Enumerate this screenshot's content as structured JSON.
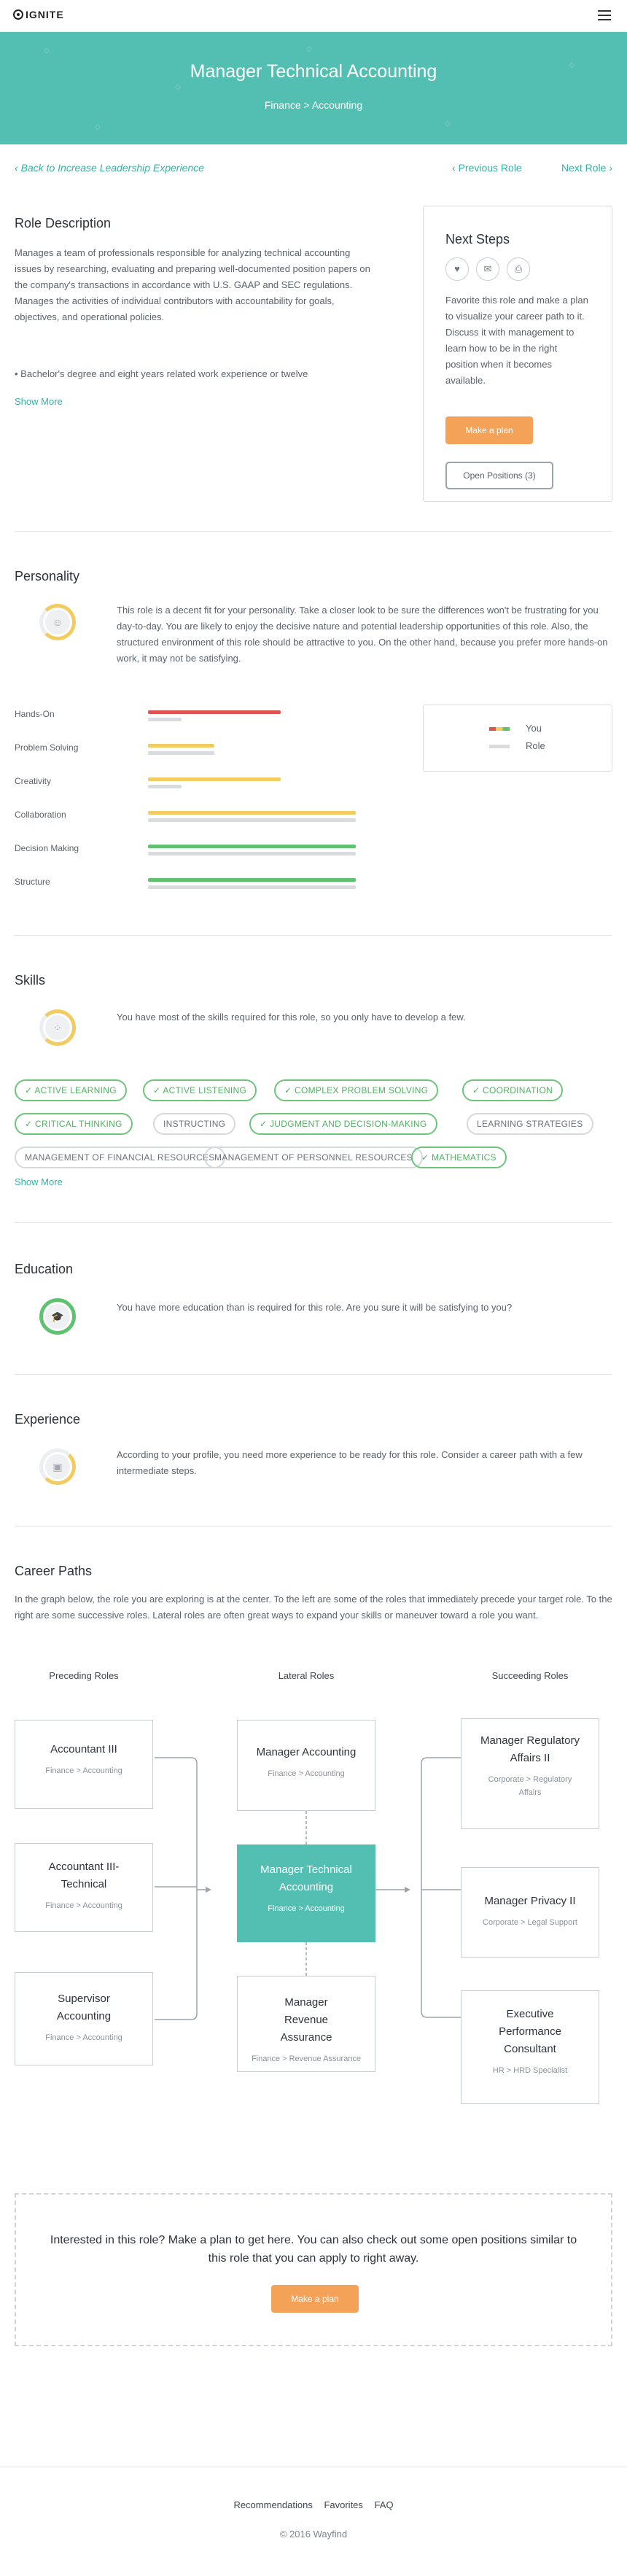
{
  "brand": {
    "name": "IGNITE"
  },
  "header": {
    "title": "Manager Technical Accounting",
    "breadcrumb": "Finance > Accounting"
  },
  "subnav": {
    "back": "Back to Increase Leadership Experience",
    "previous": "Previous Role",
    "next": "Next Role"
  },
  "role_description": {
    "heading": "Role Description",
    "text": "Manages a team of professionals responsible for analyzing technical accounting issues by researching, evaluating and preparing well-documented position papers on the company's transactions in accordance with U.S. GAAP and SEC regulations. Manages the activities of individual contributors with accountability for goals, objectives, and operational policies.",
    "bullet": "• Bachelor's degree and eight years related work experience or twelve",
    "show_more": "Show More"
  },
  "next_steps": {
    "heading": "Next Steps",
    "text": "Favorite this role and make a plan to visualize your career path to it. Discuss it with management to learn how to be in the right position when it becomes available.",
    "make_plan": "Make a plan",
    "open_positions": "Open Positions (3)",
    "icons": [
      "heart-icon",
      "mail-icon",
      "print-icon"
    ]
  },
  "personality": {
    "heading": "Personality",
    "text": "This role is a decent fit for your personality. Take a closer look to be sure the differences won't be frustrating for you day-to-day. You are likely to enjoy the decisive nature and potential leadership opportunities of this role. Also, the structured environment of this role should be attractive to you. On the other hand, because you prefer more hands-on work, it may not be satisfying.",
    "traits": [
      {
        "label": "Hands-On",
        "you": 0.8,
        "role": 0.2,
        "color": "#e05353"
      },
      {
        "label": "Problem Solving",
        "you": 0.4,
        "role": 0.4,
        "color": "#f2cc60"
      },
      {
        "label": "Creativity",
        "you": 0.8,
        "role": 0.2,
        "color": "#f2cc60"
      },
      {
        "label": "Collaboration",
        "you": 1.0,
        "role": 1.0,
        "color": "#f2cc60"
      },
      {
        "label": "Decision Making",
        "you": 1.0,
        "role": 1.0,
        "color": "#5fc26f"
      },
      {
        "label": "Structure",
        "you": 1.0,
        "role": 1.0,
        "color": "#5fc26f"
      }
    ],
    "legend": {
      "you": "You",
      "role": "Role"
    }
  },
  "skills": {
    "heading": "Skills",
    "text": "You have most of the skills required for this role, so you only have to develop a few.",
    "items": [
      {
        "label": "ACTIVE LEARNING",
        "have": true
      },
      {
        "label": "ACTIVE LISTENING",
        "have": true
      },
      {
        "label": "COMPLEX PROBLEM SOLVING",
        "have": true
      },
      {
        "label": "COORDINATION",
        "have": true
      },
      {
        "label": "CRITICAL THINKING",
        "have": true
      },
      {
        "label": "INSTRUCTING",
        "have": false
      },
      {
        "label": "JUDGMENT AND DECISION-MAKING",
        "have": true
      },
      {
        "label": "LEARNING STRATEGIES",
        "have": false
      },
      {
        "label": "MANAGEMENT OF FINANCIAL RESOURCES",
        "have": false
      },
      {
        "label": "MANAGEMENT OF PERSONNEL RESOURCES",
        "have": false
      },
      {
        "label": "MATHEMATICS",
        "have": true
      }
    ],
    "show_more": "Show More"
  },
  "education": {
    "heading": "Education",
    "text": "You have more education than is required for this role. Are you sure it will be satisfying to you?"
  },
  "experience": {
    "heading": "Experience",
    "text": "According to your profile, you need more experience to be ready for this role. Consider a career path with a few intermediate steps."
  },
  "career_paths": {
    "heading": "Career Paths",
    "text": "In the graph below, the role you are exploring is at the center. To the left are some of the roles that immediately precede your target role. To the right are some successive roles. Lateral roles are often great ways to expand your skills or maneuver toward a role you want.",
    "columns": {
      "preceding": "Preceding Roles",
      "lateral": "Lateral Roles",
      "succeeding": "Succeeding Roles"
    },
    "preceding": [
      {
        "title": "Accountant III",
        "sub": "Finance > Accounting"
      },
      {
        "title": "Accountant III-Technical",
        "sub": "Finance > Accounting"
      },
      {
        "title": "Supervisor Accounting",
        "sub": "Finance > Accounting"
      }
    ],
    "lateral_top": {
      "title": "Manager Accounting",
      "sub": "Finance > Accounting"
    },
    "center": {
      "title": "Manager Technical Accounting",
      "sub": "Finance > Accounting"
    },
    "lateral_bottom": {
      "title": "Manager Revenue Assurance",
      "sub": "Finance > Revenue Assurance"
    },
    "succeeding": [
      {
        "title": "Manager Regulatory Affairs II",
        "sub": "Corporate > Regulatory Affairs"
      },
      {
        "title": "Manager Privacy II",
        "sub": "Corporate > Legal Support"
      },
      {
        "title": "Executive Performance Consultant",
        "sub": "HR > HRD Specialist"
      }
    ]
  },
  "cta": {
    "text": "Interested in this role? Make a plan to get here. You can also check out some open positions similar to this role that you can apply to right away.",
    "button": "Make a plan"
  },
  "footer": {
    "links": [
      "Recommendations",
      "Favorites",
      "FAQ"
    ],
    "copyright": "© 2016 Wayfind"
  },
  "colors": {
    "accent": "#53bfb2",
    "orange": "#f5a259",
    "green": "#5fc26f",
    "yellow": "#f2cc60",
    "red": "#e05353"
  }
}
